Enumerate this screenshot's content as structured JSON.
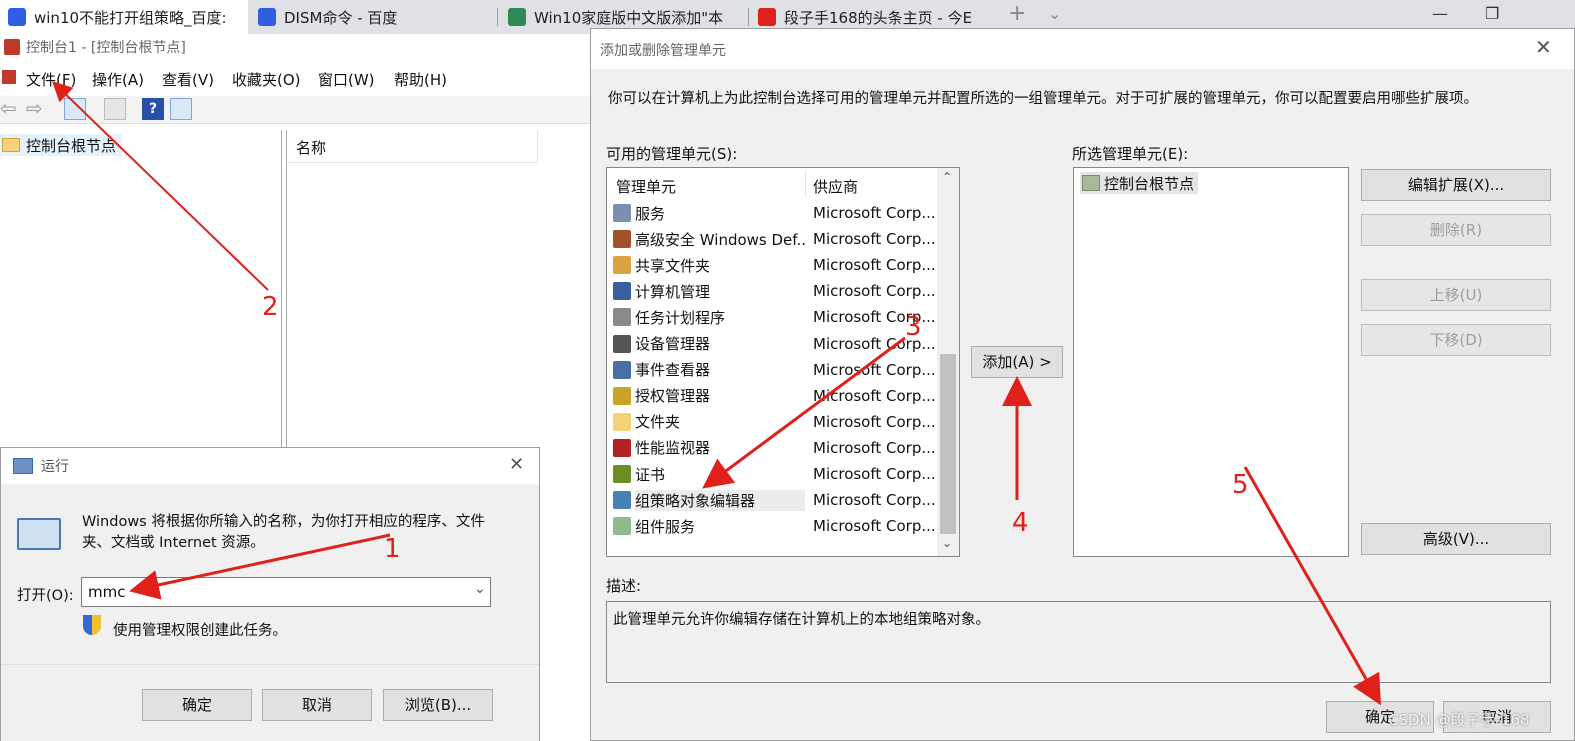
{
  "browser": {
    "tabs": [
      {
        "title": "win10不能打开组策略_百度:",
        "icon": "baidu-paw-icon"
      },
      {
        "title": "DISM命令 - 百度",
        "icon": "baidu-paw-icon"
      },
      {
        "title": "Win10家庭版中文版添加\"本",
        "icon": "green-leaf-icon"
      },
      {
        "title": "段子手168的头条主页 - 今E",
        "icon": "toutiao-icon"
      }
    ]
  },
  "mmc": {
    "title": "控制台1 - [控制台根节点]",
    "menu": [
      "文件(F)",
      "操作(A)",
      "查看(V)",
      "收藏夹(O)",
      "窗口(W)",
      "帮助(H)"
    ],
    "tree_root": "控制台根节点",
    "list_header": "名称"
  },
  "snapin_dialog": {
    "title": "添加或删除管理单元",
    "intro": "你可以在计算机上为此控制台选择可用的管理单元并配置所选的一组管理单元。对于可扩展的管理单元，你可以配置要启用哪些扩展项。",
    "available_label": "可用的管理单元(S):",
    "col_snapin": "管理单元",
    "col_vendor": "供应商",
    "items": [
      {
        "name": "服务",
        "vendor": "Microsoft Corp...",
        "color": "#7b8fb0"
      },
      {
        "name": "高级安全 Windows Def...",
        "vendor": "Microsoft Corp...",
        "color": "#a0522d"
      },
      {
        "name": "共享文件夹",
        "vendor": "Microsoft Corp...",
        "color": "#d9a441"
      },
      {
        "name": "计算机管理",
        "vendor": "Microsoft Corp...",
        "color": "#3a5f9e"
      },
      {
        "name": "任务计划程序",
        "vendor": "Microsoft Corp...",
        "color": "#8a8a8a"
      },
      {
        "name": "设备管理器",
        "vendor": "Microsoft Corp...",
        "color": "#555555"
      },
      {
        "name": "事件查看器",
        "vendor": "Microsoft Corp...",
        "color": "#4a6fa5"
      },
      {
        "name": "授权管理器",
        "vendor": "Microsoft Corp...",
        "color": "#c9a227"
      },
      {
        "name": "文件夹",
        "vendor": "Microsoft Corp...",
        "color": "#f4d27a"
      },
      {
        "name": "性能监视器",
        "vendor": "Microsoft Corp...",
        "color": "#b22222"
      },
      {
        "name": "证书",
        "vendor": "Microsoft Corp...",
        "color": "#6b8e23"
      },
      {
        "name": "组策略对象编辑器",
        "vendor": "Microsoft Corp...",
        "color": "#4682b4"
      },
      {
        "name": "组件服务",
        "vendor": "Microsoft Corp...",
        "color": "#8fbc8f"
      }
    ],
    "selected_index": 11,
    "add_button": "添加(A) >",
    "selected_label": "所选管理单元(E):",
    "selected_items": [
      "控制台根节点"
    ],
    "buttons": {
      "edit_ext": "编辑扩展(X)...",
      "remove": "删除(R)",
      "move_up": "上移(U)",
      "move_down": "下移(D)",
      "advanced": "高级(V)..."
    },
    "desc_label": "描述:",
    "desc_text": "此管理单元允许你编辑存储在计算机上的本地组策略对象。",
    "ok": "确定",
    "cancel": "取消"
  },
  "run_dialog": {
    "title": "运行",
    "description": "Windows 将根据你所输入的名称，为你打开相应的程序、文件夹、文档或 Internet 资源。",
    "open_label": "打开(O):",
    "input_value": "mmc",
    "admin_note": "使用管理权限创建此任务。",
    "ok": "确定",
    "cancel": "取消",
    "browse": "浏览(B)..."
  },
  "annotations": [
    "1",
    "2",
    "3",
    "4",
    "5"
  ],
  "watermark": "CSDN @段子手-168",
  "colors": {
    "annotation_red": "#e0201a",
    "dialog_bg": "#f0f0f0",
    "selection": "#cce8ff"
  }
}
